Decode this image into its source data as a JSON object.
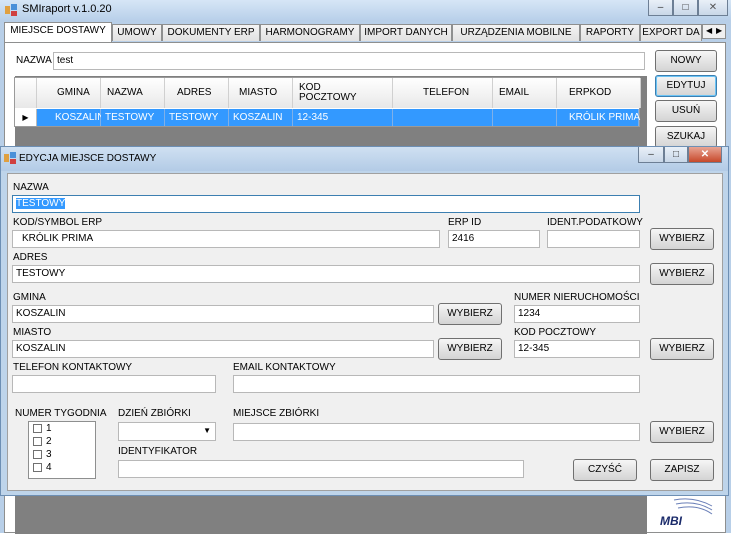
{
  "app": {
    "title": "SMIraport v.1.0.20"
  },
  "tabs": [
    "MIEJSCE DOSTAWY",
    "UMOWY",
    "DOKUMENTY ERP",
    "HARMONOGRAMY",
    "IMPORT DANYCH",
    "URZĄDZENIA MOBILNE",
    "RAPORTY",
    "EXPORT DA"
  ],
  "filter": {
    "label": "NAZWA",
    "value": "test"
  },
  "side_buttons": {
    "new": "NOWY",
    "edit": "EDYTUJ",
    "delete": "USUŃ",
    "search": "SZUKAJ"
  },
  "grid": {
    "columns": [
      "GMINA",
      "NAZWA",
      "ADRES",
      "MIASTO",
      "KOD POCZTOWY",
      "TELEFON",
      "EMAIL",
      "ERPKOD"
    ],
    "rows": [
      [
        "KOSZALIN",
        "TESTOWY",
        "TESTOWY",
        "KOSZALIN",
        "12-345",
        "",
        "",
        "KRÓLIK PRIMA"
      ]
    ]
  },
  "dialog": {
    "title": "EDYCJA MIEJSCE DOSTAWY",
    "labels": {
      "name": "NAZWA",
      "erp_code": "KOD/SYMBOL ERP",
      "erp_id": "ERP ID",
      "tax_id": "IDENT.PODATKOWY",
      "address": "ADRES",
      "commune": "GMINA",
      "property_no": "NUMER NIERUCHOMOŚCI",
      "city": "MIASTO",
      "postal_code": "KOD POCZTOWY",
      "phone": "TELEFON KONTAKTOWY",
      "email": "EMAIL KONTAKTOWY",
      "week_no": "NUMER TYGODNIA",
      "pickup_day": "DZIEŃ ZBIÓRKI",
      "pickup_place": "MIEJSCE ZBIÓRKI",
      "identifier": "IDENTYFIKATOR"
    },
    "values": {
      "name": "TESTOWY",
      "erp_code": "KRÓLIK PRIMA",
      "erp_id": "2416",
      "tax_id": "",
      "address": "TESTOWY",
      "commune": "KOSZALIN",
      "property_no": "1234",
      "city": "KOSZALIN",
      "postal_code": "12-345",
      "phone": "",
      "email": "",
      "pickup_day": "",
      "pickup_place": "",
      "identifier": ""
    },
    "week_options": [
      "1",
      "2",
      "3",
      "4"
    ],
    "buttons": {
      "choose": "WYBIERZ",
      "clear": "CZYŚĆ",
      "save": "ZAPISZ"
    }
  },
  "logo": {
    "text": "MBI"
  },
  "colors": {
    "selection": "#3399ff",
    "title_bar": "#b9d0ea"
  }
}
